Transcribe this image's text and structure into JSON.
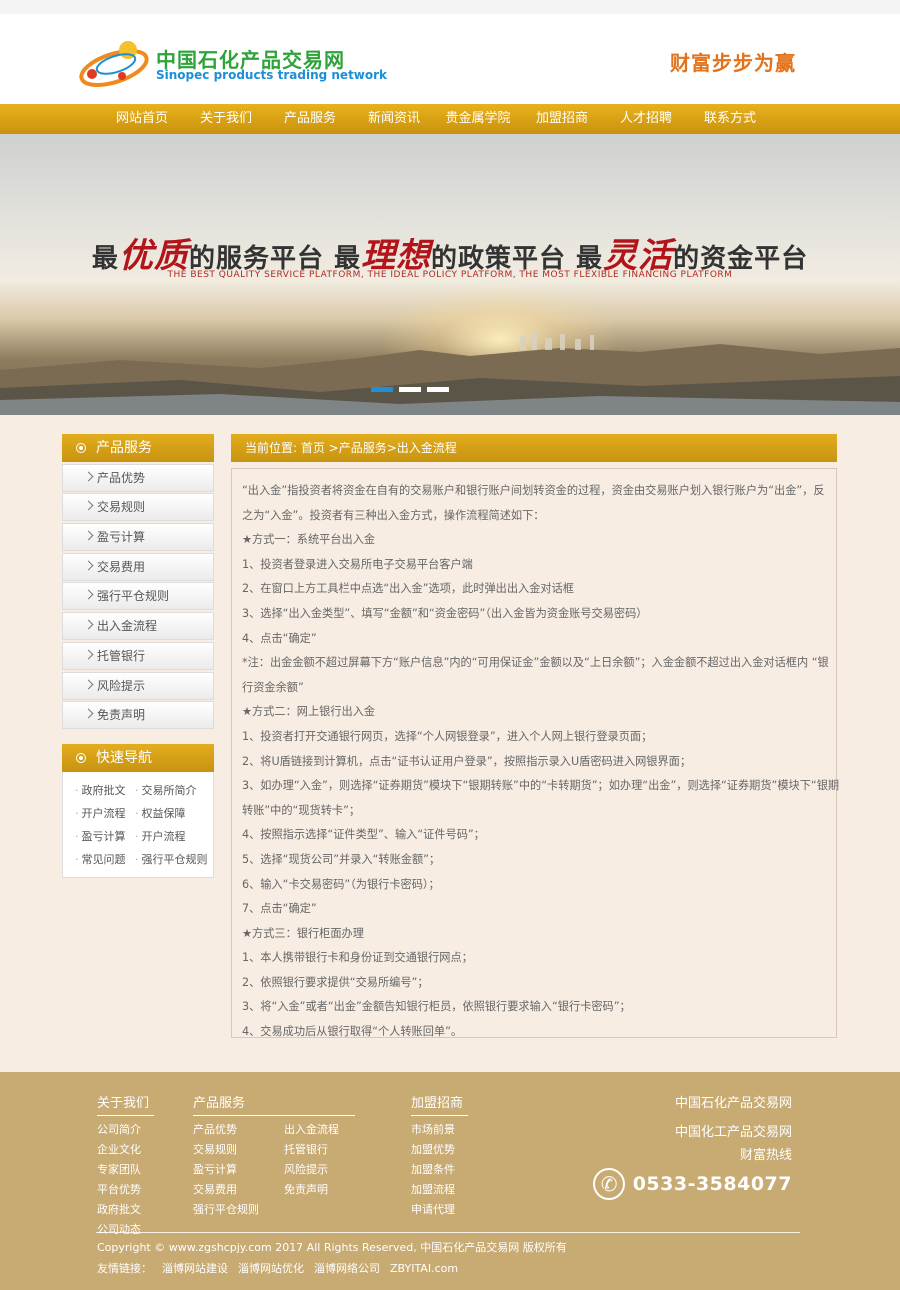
{
  "header": {
    "logo_cn": "中国石化产品交易网",
    "logo_en": "Sinopec products trading network",
    "slogan": "财富步步为赢"
  },
  "nav": [
    "网站首页",
    "关于我们",
    "产品服务",
    "新闻资讯",
    "贵金属学院",
    "加盟招商",
    "人才招聘",
    "联系方式"
  ],
  "banner": {
    "t1": "最",
    "h1": "优质",
    "t2": "的服务平台 最",
    "h2": "理想",
    "t3": "的政策平台 最",
    "h3": "灵活",
    "t4": "的资金平台",
    "subtitle": "THE BEST QUALITY SERVICE PLATFORM, THE IDEAL POLICY PLATFORM, THE MOST FLEXIBLE FINANCING PLATFORM"
  },
  "sidebar": {
    "title": "产品服务",
    "items": [
      "产品优势",
      "交易规则",
      "盈亏计算",
      "交易费用",
      "强行平仓规则",
      "出入金流程",
      "托管银行",
      "风险提示",
      "免责声明"
    ]
  },
  "quicknav": {
    "title": "快速导航",
    "items": [
      "政府批文",
      "交易所简介",
      "开户流程",
      "权益保障",
      "盈亏计算",
      "开户流程",
      "常见问题",
      "强行平仓规则"
    ]
  },
  "main": {
    "breadcrumb": "当前位置: 首页 >产品服务>出入金流程",
    "paragraphs": [
      "“出入金”指投资者将资金在自有的交易账户和银行账户间划转资金的过程，资金由交易账户划入银行账户为“出金”，反",
      "之为“入金”。投资者有三种出入金方式，操作流程简述如下：",
      "★方式一：系统平台出入金",
      "1、投资者登录进入交易所电子交易平台客户端",
      "2、在窗口上方工具栏中点选“出入金”选项，此时弹出出入金对话框",
      "3、选择“出入金类型”、填写“金额”和“资金密码”（出入金皆为资金账号交易密码）",
      "4、点击“确定”",
      "*注：出金金额不超过屏幕下方“账户信息”内的“可用保证金”金额以及“上日余额”；入金金额不超过出入金对话框内 “银",
      "行资金余额”",
      "★方式二：网上银行出入金",
      "1、投资者打开交通银行网页，选择“个人网银登录”，进入个人网上银行登录页面；",
      "2、将U盾链接到计算机，点击“证书认证用户登录”，按照指示录入U盾密码进入网银界面；",
      "3、如办理“入金”，则选择“证券期货”模块下“银期转账”中的“卡转期货”；如办理“出金”，则选择“证券期货”模块下“银期",
      "转账”中的“现货转卡”；",
      "4、按照指示选择“证件类型”、输入“证件号码”；",
      "5、选择“现货公司”并录入“转账金额”；",
      "6、输入“卡交易密码”（为银行卡密码）；",
      "7、点击“确定”",
      "★方式三：银行柜面办理",
      "1、本人携带银行卡和身份证到交通银行网点；",
      "2、依照银行要求提供“交易所编号”；",
      "3、将“入金”或者“出金”金额告知银行柜员，依照银行要求输入“银行卡密码”；",
      "4、交易成功后从银行取得“个人转账回单”。"
    ]
  },
  "footer": {
    "about": {
      "title": "关于我们",
      "items": [
        "公司简介",
        "企业文化",
        "专家团队",
        "平台优势",
        "政府批文",
        "公司动态"
      ]
    },
    "products": {
      "title": "产品服务",
      "col1": [
        "产品优势",
        "交易规则",
        "盈亏计算",
        "交易费用",
        "强行平仓规则"
      ],
      "col2": [
        "出入金流程",
        "托管银行",
        "风险提示",
        "免责声明"
      ]
    },
    "join": {
      "title": "加盟招商",
      "items": [
        "市场前景",
        "加盟优势",
        "加盟条件",
        "加盟流程",
        "申请代理"
      ]
    },
    "right_line1": "中国石化产品交易网",
    "right_line2": "中国化工产品交易网",
    "right_line3": "财富热线",
    "phone": "0533-3584077",
    "copyright": "Copyright © www.zgshcpjy.com 2017 All Rights Reserved, 中国石化产品交易网 版权所有",
    "links_label": "友情链接：",
    "links": [
      "淄博网站建设",
      "淄博网站优化",
      "淄博网络公司",
      "ZBYITAI.com"
    ]
  }
}
